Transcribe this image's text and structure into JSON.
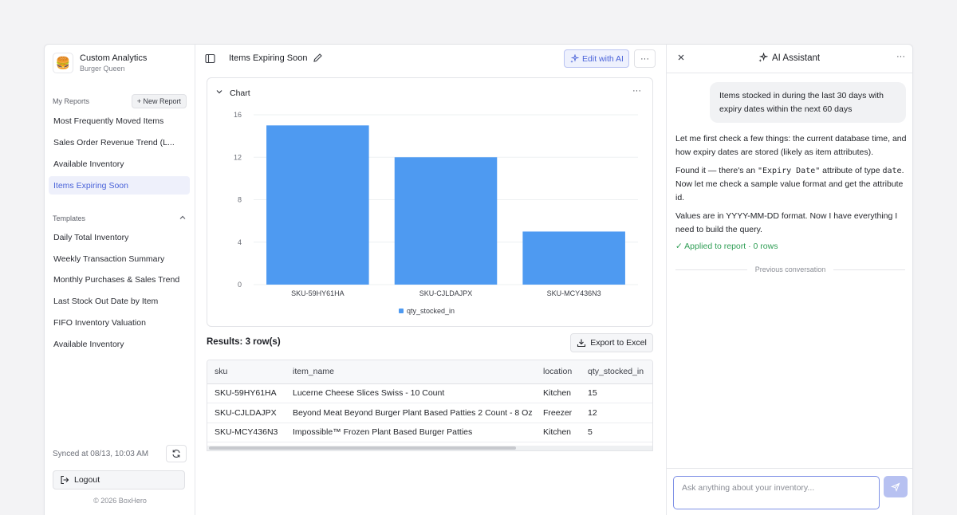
{
  "sidebar": {
    "brand_title": "Custom Analytics",
    "brand_sub": "Burger Queen",
    "my_reports_label": "My Reports",
    "new_report_label": "+ New Report",
    "reports": [
      "Most Frequently Moved Items",
      "Sales Order Revenue Trend (L...",
      "Available Inventory",
      "Items Expiring Soon"
    ],
    "active_report": "Items Expiring Soon",
    "templates_label": "Templates",
    "templates": [
      "Daily Total Inventory",
      "Weekly Transaction Summary",
      "Monthly Purchases & Sales Trend",
      "Last Stock Out Date by Item",
      "FIFO Inventory Valuation",
      "Available Inventory"
    ],
    "sync_text": "Synced at 08/13, 10:03 AM",
    "logout_label": "Logout",
    "copyright": "© 2026 BoxHero"
  },
  "topbar": {
    "report_title": "Items Expiring Soon",
    "edit_ai_label": "Edit with AI",
    "more_label": "···"
  },
  "chart": {
    "section_label": "Chart",
    "more_label": "···"
  },
  "chart_data": {
    "type": "bar",
    "categories": [
      "SKU-59HY61HA",
      "SKU-CJLDAJPX",
      "SKU-MCY436N3"
    ],
    "series": [
      {
        "name": "qty_stocked_in",
        "values": [
          15,
          12,
          5
        ]
      }
    ],
    "yticks": [
      0,
      4,
      8,
      12,
      16
    ],
    "ylim": [
      0,
      16
    ],
    "grid": true,
    "legend": "bottom",
    "color": "#4e9af1"
  },
  "results": {
    "label": "Results: 3 row(s)",
    "export_label": "Export to Excel",
    "columns": [
      "sku",
      "item_name",
      "location",
      "qty_stocked_in"
    ],
    "rows": [
      [
        "SKU-59HY61HA",
        "Lucerne Cheese Slices Swiss - 10 Count",
        "Kitchen",
        "15"
      ],
      [
        "SKU-CJLDAJPX",
        "Beyond Meat Beyond Burger Plant Based Patties 2 Count - 8 Oz",
        "Freezer",
        "12"
      ],
      [
        "SKU-MCY436N3",
        "Impossible™ Frozen Plant Based Burger Patties",
        "Kitchen",
        "5"
      ]
    ]
  },
  "ai": {
    "title": "AI Assistant",
    "more_label": "···",
    "user_message": "Items stocked in during the last 30 days with expiry dates within the next 60 days",
    "msg1": "Let me first check a few things: the current database time, and how expiry dates are stored (likely as item attributes).",
    "msg2_a": "Found it — there's an ",
    "msg2_code1": "\"Expiry Date\"",
    "msg2_b": " attribute of type ",
    "msg2_code2": "date",
    "msg2_c": ". Now let me check a sample value format and get the attribute id.",
    "msg3": "Values are in YYYY-MM-DD format. Now I have everything I need to build the query.",
    "applied": "✓ Applied to report · 0 rows",
    "previous": "Previous conversation",
    "input_placeholder": "Ask anything about your inventory..."
  },
  "colors": {
    "accent": "#4a63d9",
    "bar": "#4e9af1",
    "success": "#2f9e55"
  }
}
